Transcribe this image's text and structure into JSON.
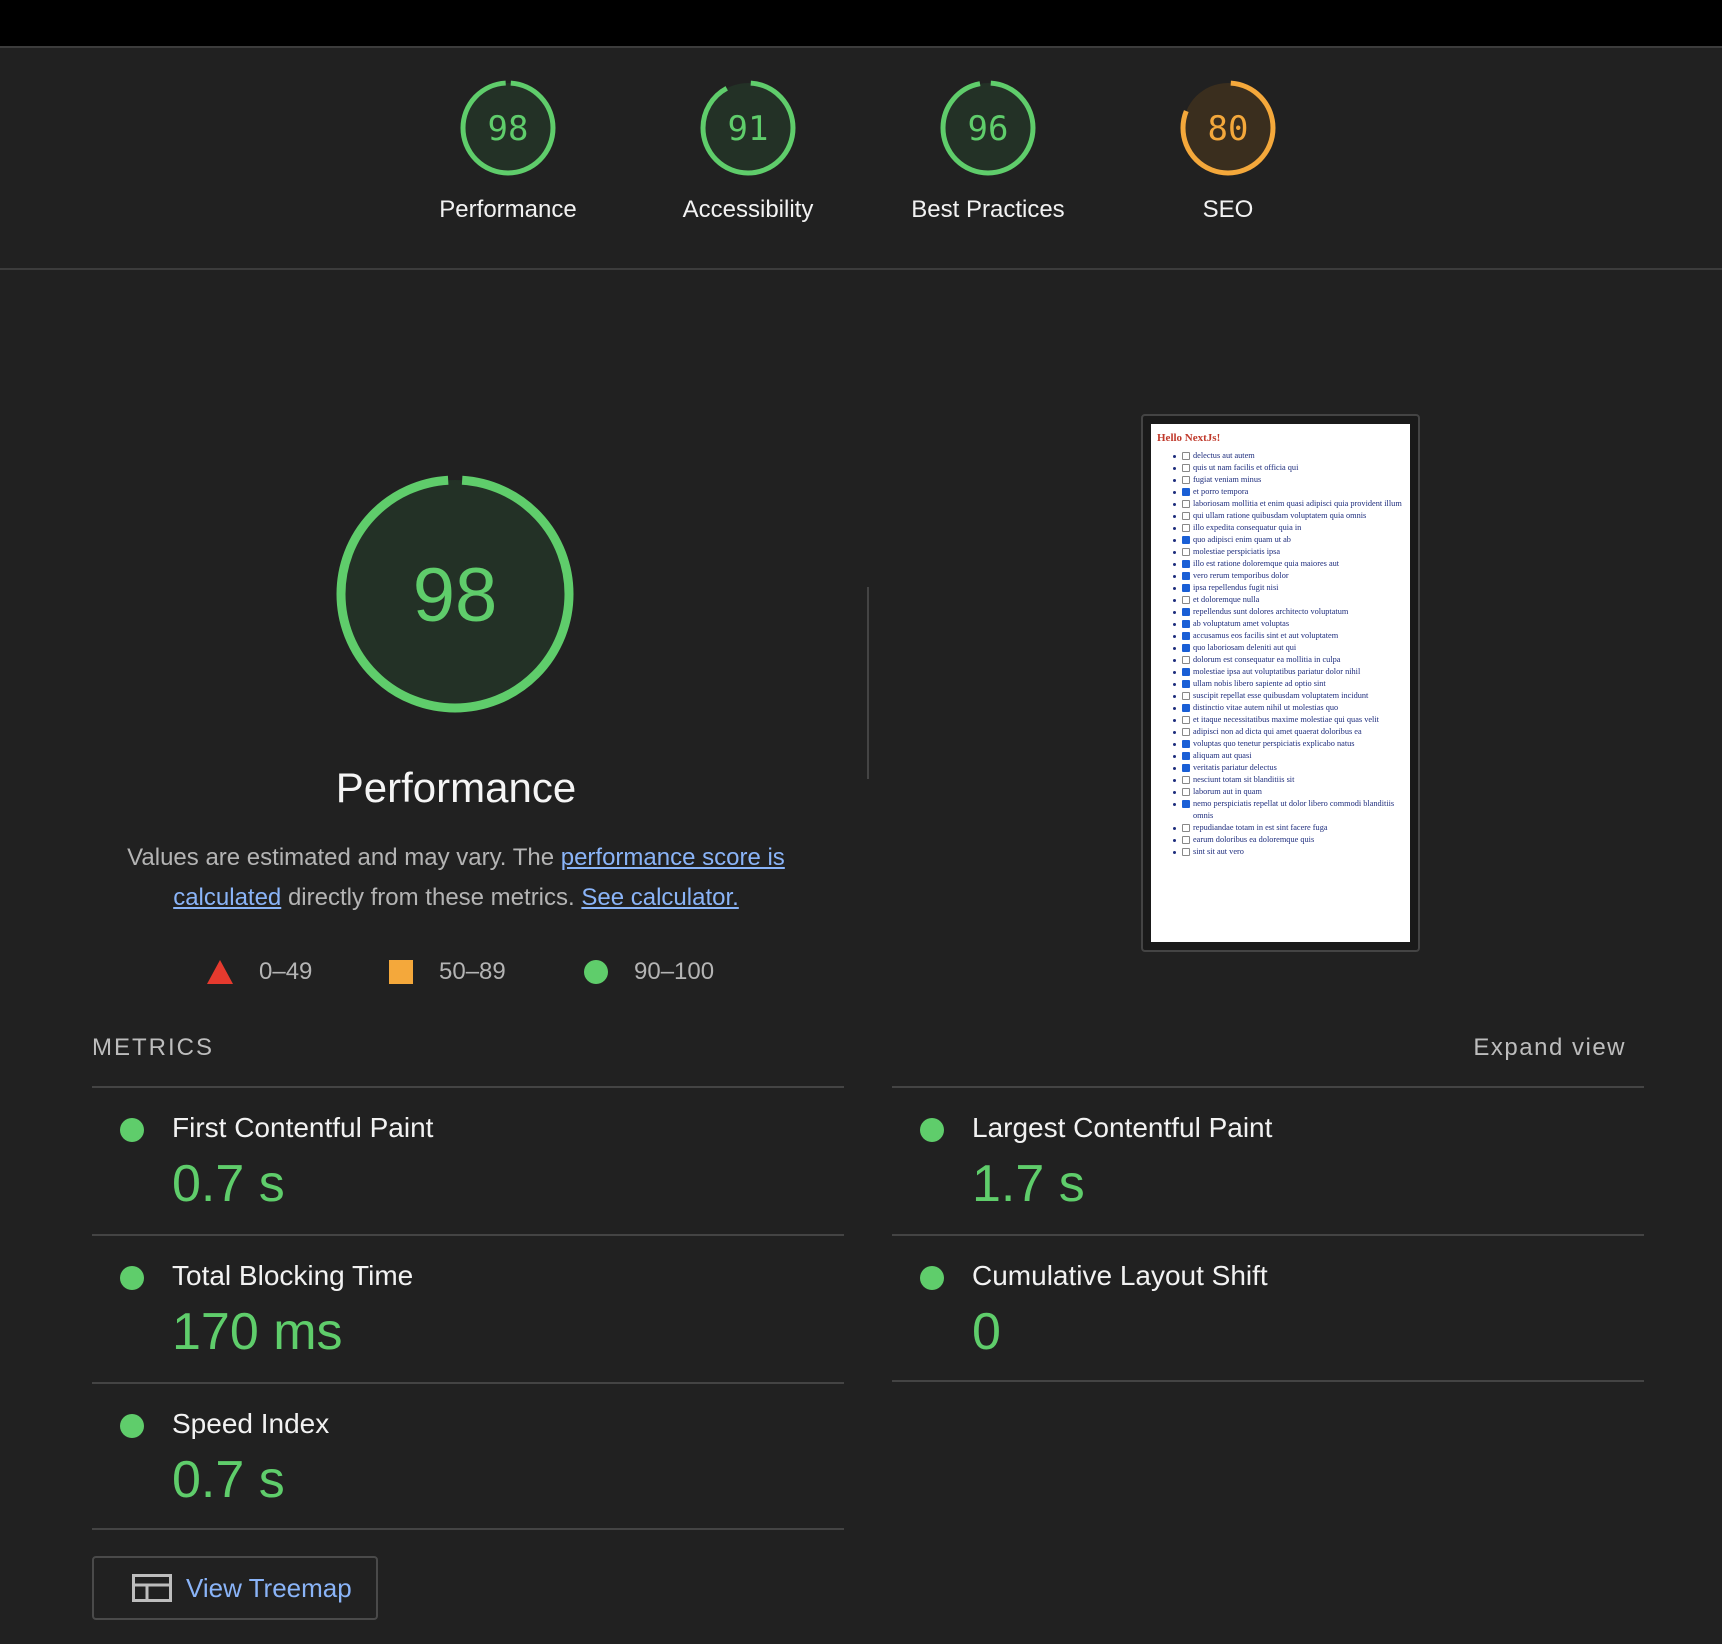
{
  "colors": {
    "pass": "#5fcd6b",
    "average": "#f4a83b",
    "fail": "#e63a2e",
    "link": "#8ab4f8"
  },
  "categories": [
    {
      "label": "Performance",
      "score": 98,
      "status": "pass"
    },
    {
      "label": "Accessibility",
      "score": 91,
      "status": "pass"
    },
    {
      "label": "Best Practices",
      "score": 96,
      "status": "pass"
    },
    {
      "label": "SEO",
      "score": 80,
      "status": "average"
    }
  ],
  "main": {
    "score": 98,
    "title": "Performance",
    "desc_before": "Values are estimated and may vary. The ",
    "desc_link1": "performance score is calculated",
    "desc_middle": " directly from these metrics. ",
    "desc_link2": "See calculator."
  },
  "legend": [
    {
      "icon": "triangle-icon",
      "range": "0–49"
    },
    {
      "icon": "square-icon",
      "range": "50–89"
    },
    {
      "icon": "circle-icon",
      "range": "90–100"
    }
  ],
  "thumbnail": {
    "title": "Hello NextJs!",
    "items": [
      {
        "text": "delectus aut autem",
        "checked": false
      },
      {
        "text": "quis ut nam facilis et officia qui",
        "checked": false
      },
      {
        "text": "fugiat veniam minus",
        "checked": false
      },
      {
        "text": "et porro tempora",
        "checked": true
      },
      {
        "text": "laboriosam mollitia et enim quasi adipisci quia provident illum",
        "checked": false
      },
      {
        "text": "qui ullam ratione quibusdam voluptatem quia omnis",
        "checked": false
      },
      {
        "text": "illo expedita consequatur quia in",
        "checked": false
      },
      {
        "text": "quo adipisci enim quam ut ab",
        "checked": true
      },
      {
        "text": "molestiae perspiciatis ipsa",
        "checked": false
      },
      {
        "text": "illo est ratione doloremque quia maiores aut",
        "checked": true
      },
      {
        "text": "vero rerum temporibus dolor",
        "checked": true
      },
      {
        "text": "ipsa repellendus fugit nisi",
        "checked": true
      },
      {
        "text": "et doloremque nulla",
        "checked": false
      },
      {
        "text": "repellendus sunt dolores architecto voluptatum",
        "checked": true
      },
      {
        "text": "ab voluptatum amet voluptas",
        "checked": true
      },
      {
        "text": "accusamus eos facilis sint et aut voluptatem",
        "checked": true
      },
      {
        "text": "quo laboriosam deleniti aut qui",
        "checked": true
      },
      {
        "text": "dolorum est consequatur ea mollitia in culpa",
        "checked": false
      },
      {
        "text": "molestiae ipsa aut voluptatibus pariatur dolor nihil",
        "checked": true
      },
      {
        "text": "ullam nobis libero sapiente ad optio sint",
        "checked": true
      },
      {
        "text": "suscipit repellat esse quibusdam voluptatem incidunt",
        "checked": false
      },
      {
        "text": "distinctio vitae autem nihil ut molestias quo",
        "checked": true
      },
      {
        "text": "et itaque necessitatibus maxime molestiae qui quas velit",
        "checked": false
      },
      {
        "text": "adipisci non ad dicta qui amet quaerat doloribus ea",
        "checked": false
      },
      {
        "text": "voluptas quo tenetur perspiciatis explicabo natus",
        "checked": true
      },
      {
        "text": "aliquam aut quasi",
        "checked": true
      },
      {
        "text": "veritatis pariatur delectus",
        "checked": true
      },
      {
        "text": "nesciunt totam sit blanditiis sit",
        "checked": false
      },
      {
        "text": "laborum aut in quam",
        "checked": false
      },
      {
        "text": "nemo perspiciatis repellat ut dolor libero commodi blanditiis omnis",
        "checked": true
      },
      {
        "text": "repudiandae totam in est sint facere fuga",
        "checked": false
      },
      {
        "text": "earum doloribus ea doloremque quis",
        "checked": false
      },
      {
        "text": "sint sit aut vero",
        "checked": false
      }
    ]
  },
  "metrics": {
    "header": "METRICS",
    "expand_label": "Expand view",
    "items": [
      {
        "label": "First Contentful Paint",
        "value": "0.7 s",
        "status": "pass"
      },
      {
        "label": "Largest Contentful Paint",
        "value": "1.7 s",
        "status": "pass"
      },
      {
        "label": "Total Blocking Time",
        "value": "170 ms",
        "status": "pass"
      },
      {
        "label": "Cumulative Layout Shift",
        "value": "0",
        "status": "pass"
      },
      {
        "label": "Speed Index",
        "value": "0.7 s",
        "status": "pass"
      }
    ]
  },
  "treemap": {
    "label": "View Treemap",
    "icon": "treemap-icon"
  }
}
